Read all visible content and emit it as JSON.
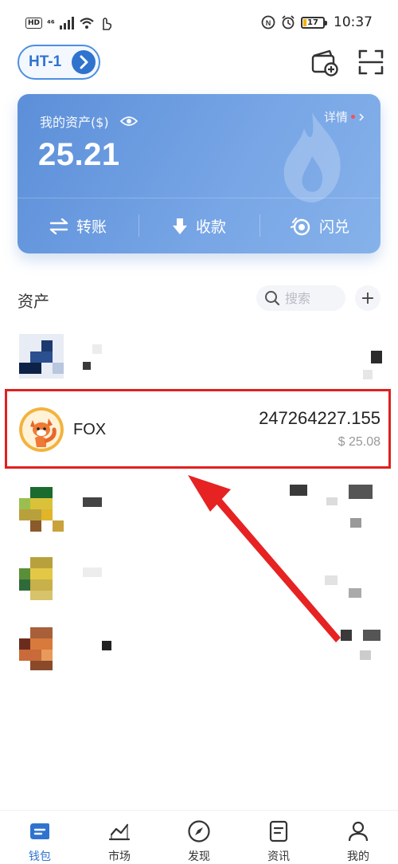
{
  "status_bar": {
    "hd": "HD",
    "signal": "⁴⁶",
    "battery": "17",
    "time": "10:37"
  },
  "header": {
    "network": "HT-1"
  },
  "card": {
    "title": "我的资产($)",
    "detail": "详情",
    "total": "25.21",
    "actions": [
      "转账",
      "收款",
      "闪兑"
    ]
  },
  "assets": {
    "title": "资产",
    "search_placeholder": "搜索",
    "add": "+"
  },
  "tokens": [
    {
      "name": "",
      "balance": "",
      "value": ""
    },
    {
      "name": "FOX",
      "balance": "247264227.155",
      "value": "$ 25.08"
    },
    {
      "name": "",
      "balance": "",
      "value": ""
    },
    {
      "name": "",
      "balance": "",
      "value": ""
    },
    {
      "name": "",
      "balance": "",
      "value": ""
    }
  ],
  "bottom_nav": [
    "钱包",
    "市场",
    "发现",
    "资讯",
    "我的"
  ],
  "colors": {
    "accent": "#2f73cf",
    "card_start": "#5c8fd9",
    "card_end": "#86b2ea",
    "annotation": "#e02020"
  },
  "icons": [
    "wallet-add-icon",
    "scan-icon",
    "eye-icon",
    "transfer-icon",
    "receive-icon",
    "swap-icon",
    "search-icon",
    "wallet-icon",
    "market-icon",
    "compass-icon",
    "news-icon",
    "profile-icon"
  ]
}
